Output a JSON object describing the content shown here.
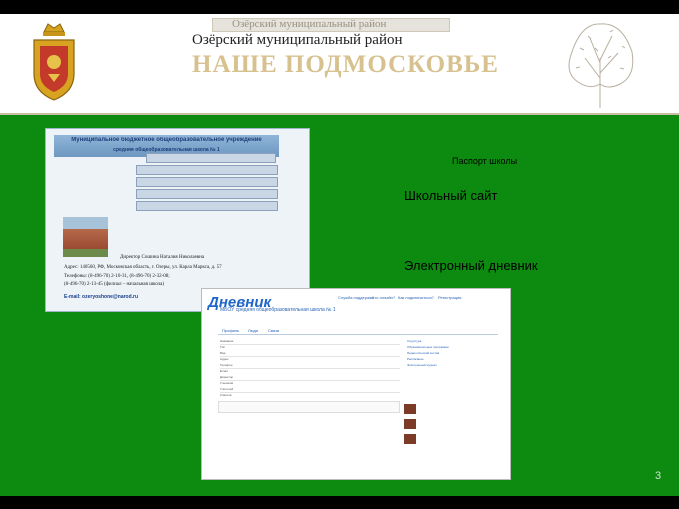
{
  "header": {
    "ghost_text": "Озёрский муниципальный район",
    "district": "Озёрский муниципальный район",
    "brand": "НАШЕ ПОДМОСКОВЬЕ"
  },
  "slide": {
    "passport_label": "Паспорт школы",
    "school_site_link": "Школьный сайт",
    "diary_link": "Электронный дневник",
    "page_number": "3"
  },
  "school_site": {
    "banner_line1": "Муниципальное бюджетное общеобразовательное учреждение",
    "banner_line2": "средняя общеобразовательная школа № 1",
    "director": "Директор Сошина Наталия Николаевна",
    "address": "Адрес: 140560, РФ, Московская область, г. Озеры, ул. Карла Маркса, д. 57",
    "phone": "Телефоны: (8-496-70) 2-10-31, (8-496-70) 2-32-08;",
    "phone2": "(8-496-70) 2-13-45 (филиал – начальная школа)",
    "email": "E-mail: ozeryoshone@narod.ru"
  },
  "diary": {
    "logo": "Дневник",
    "top_links": [
      "Служба поддержки",
      "Кто онлайн?",
      "Как подключиться?",
      "Регистрация"
    ],
    "school_title": "МБОУ средняя общеобразовательная школа № 1",
    "tabs": [
      "Профиль",
      "Люди",
      "Связи"
    ],
    "fields": [
      "Название",
      "Тип",
      "Вид",
      "Адрес",
      "Телефон",
      "Email",
      "Директор",
      "Учеников",
      "Учителей",
      "Классов"
    ],
    "side_items": [
      "Структура",
      "Образовательные программы",
      "Педагогический состав",
      "Расписание",
      "Электронный журнал"
    ]
  }
}
